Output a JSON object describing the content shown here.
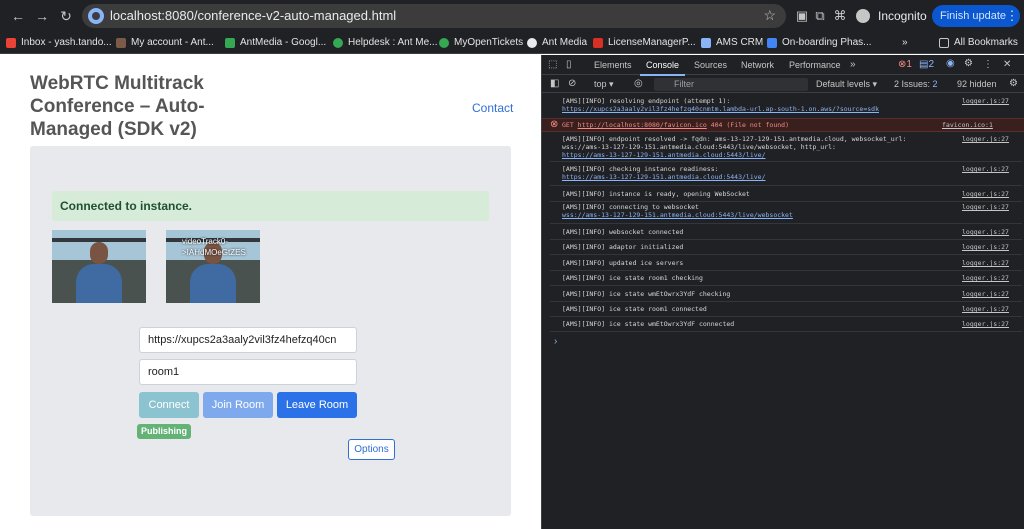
{
  "browser": {
    "url": "localhost:8080/conference-v2-auto-managed.html",
    "incognito_label": "Incognito",
    "finish_update_label": "Finish update",
    "bookmarks": [
      {
        "label": "Inbox - yash.tando...",
        "color": "#ea4335"
      },
      {
        "label": "My account - Ant...",
        "color": "#7c5a4a"
      },
      {
        "label": "AntMedia - Googl...",
        "color": "#34a853"
      },
      {
        "label": "Helpdesk : Ant Me...",
        "color": "#34a853"
      },
      {
        "label": "MyOpenTickets",
        "color": "#34a853"
      },
      {
        "label": "Ant Media",
        "color": "#e8eaed"
      },
      {
        "label": "LicenseManagerP...",
        "color": "#d93025"
      },
      {
        "label": "AMS CRM",
        "color": "#8ab4f8"
      },
      {
        "label": "On-boarding Phas...",
        "color": "#4285f4"
      }
    ],
    "all_bookmarks_label": "All Bookmarks"
  },
  "page": {
    "title": "WebRTC Multitrack Conference – Auto-Managed (SDK v2)",
    "contact_label": "Contact",
    "alert_text": "Connected to instance.",
    "remote_video_label": "videoTrack0->IAHdMOeGtZES",
    "endpoint_value": "https://xupcs2a3aaly2vil3fz4hefzq40cn",
    "room_value": "room1",
    "buttons": {
      "connect": "Connect",
      "join": "Join Room",
      "leave": "Leave Room"
    },
    "badge_label": "Publishing",
    "options_label": "Options"
  },
  "devtools": {
    "tabs": [
      "Elements",
      "Console",
      "Sources",
      "Network",
      "Performance"
    ],
    "active_tab": "Console",
    "error_count": "1",
    "message_count": "2",
    "context": "top",
    "filter_placeholder": "Filter",
    "levels_label": "Default levels",
    "issues_label": "2 Issues:",
    "issues_count": "2",
    "hidden_label": "92 hidden",
    "logs": [
      {
        "text": "[AMS][INFO] resolving endpoint (attempt 1):",
        "link": "https://xupcs2a3aaly2vil3fz4hefzq40cnmtm.lambda-url.ap-south-1.on.aws/?source=sdk",
        "src": "logger.js:27"
      },
      {
        "text": "GET ",
        "link": "http://localhost:8080/favicon.ico",
        "suffix": " 404 (File not found)",
        "src": "favicon.ico:1",
        "error": true
      },
      {
        "text": "[AMS][INFO] endpoint resolved -> fqdn: ams-13-127-129-151.antmedia.cloud, websocket_url: wss://ams-13-127-129-151.antmedia.cloud:5443/live/websocket, http_url:",
        "link": "https://ams-13-127-129-151.antmedia.cloud:5443/live/",
        "src": "logger.js:27"
      },
      {
        "text": "[AMS][INFO] checking instance readiness:",
        "link": "https://ams-13-127-129-151.antmedia.cloud:5443/live/",
        "src": "logger.js:27"
      },
      {
        "text": "[AMS][INFO] instance is ready, opening WebSocket",
        "src": "logger.js:27"
      },
      {
        "text": "[AMS][INFO] connecting to websocket",
        "link": "wss://ams-13-127-129-151.antmedia.cloud:5443/live/websocket",
        "src": "logger.js:27"
      },
      {
        "text": "[AMS][INFO] websocket connected",
        "src": "logger.js:27"
      },
      {
        "text": "[AMS][INFO] adaptor initialized",
        "src": "logger.js:27"
      },
      {
        "text": "[AMS][INFO] updated ice servers",
        "src": "logger.js:27"
      },
      {
        "text": "[AMS][INFO] ice state room1 checking",
        "src": "logger.js:27"
      },
      {
        "text": "[AMS][INFO] ice state wmEtOwrx3YdF checking",
        "src": "logger.js:27"
      },
      {
        "text": "[AMS][INFO] ice state room1 connected",
        "src": "logger.js:27"
      },
      {
        "text": "[AMS][INFO] ice state wmEtOwrx3YdF connected",
        "src": "logger.js:27"
      }
    ],
    "prompt_symbol": "›"
  }
}
